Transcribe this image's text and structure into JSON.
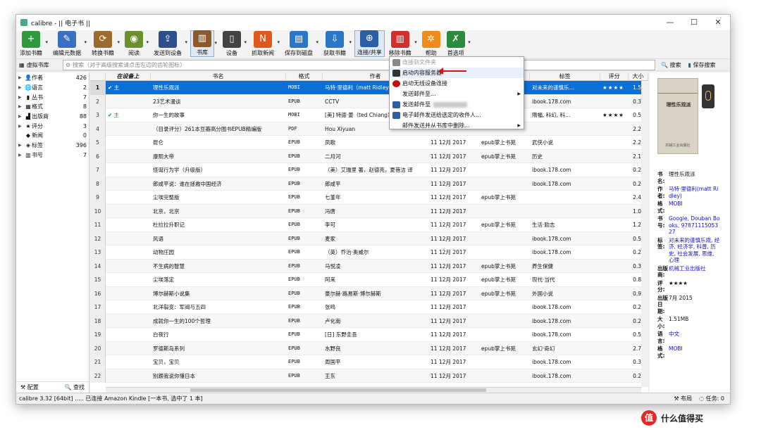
{
  "window": {
    "title": "calibre - || 电子书 ||",
    "minimize": "—",
    "maximize": "☐",
    "close": "✕"
  },
  "toolbar": [
    {
      "label": "添加书籍",
      "color": "#2e9a3a",
      "glyph": "+",
      "arrow": true
    },
    {
      "label": "编辑元数据",
      "color": "#3a6fc2",
      "glyph": "✎",
      "arrow": true
    },
    {
      "label": "转换书籍",
      "color": "#9b6a2f",
      "glyph": "⟳",
      "arrow": true
    },
    {
      "label": "阅读",
      "color": "#6b8f2e",
      "glyph": "◉",
      "arrow": true
    },
    {
      "label": "发送到设备",
      "color": "#2d4f8a",
      "glyph": "⇪",
      "arrow": true
    },
    {
      "label": "书库",
      "color": "#8a5a2c",
      "glyph": "▥",
      "arrow": true,
      "active": true
    },
    {
      "label": "设备",
      "color": "#444444",
      "glyph": "▯",
      "arrow": true
    },
    {
      "label": "抓取新闻",
      "color": "#e2571b",
      "glyph": "N",
      "arrow": true
    },
    {
      "label": "保存到磁盘",
      "color": "#2a77c9",
      "glyph": "▤",
      "arrow": true
    },
    {
      "label": "获取书籍",
      "color": "#2a77c9",
      "glyph": "⇩",
      "arrow": true
    },
    {
      "label": "连接/共享",
      "color": "#2a5fa8",
      "glyph": "⊕",
      "arrow": false,
      "active": true
    },
    {
      "label": "移除书籍",
      "color": "#d32d2d",
      "glyph": "▥",
      "arrow": true
    },
    {
      "label": "帮助",
      "color": "#f08a1a",
      "glyph": "✲",
      "arrow": false
    },
    {
      "label": "首选项",
      "color": "#2b8a3e",
      "glyph": "✗",
      "arrow": true
    }
  ],
  "search": {
    "virtual_library": "虚拟书库",
    "placeholder": "搜索（对于高级搜索请点击左边的齿轮图标）",
    "search_button": "搜索",
    "save_search_button": "保存搜索"
  },
  "tag_browser": {
    "items": [
      {
        "name": "作者",
        "count": "426",
        "icon": "👤",
        "expandable": true
      },
      {
        "name": "语言",
        "count": "2",
        "icon": "🌐",
        "expandable": true
      },
      {
        "name": "丛书",
        "count": "7",
        "icon": "▮",
        "expandable": true
      },
      {
        "name": "格式",
        "count": "8",
        "icon": "▦",
        "expandable": true
      },
      {
        "name": "出版商",
        "count": "88",
        "icon": "▟",
        "expandable": true
      },
      {
        "name": "评分",
        "count": "3",
        "icon": "★",
        "expandable": true
      },
      {
        "name": "新闻",
        "count": "0",
        "icon": "◆",
        "expandable": false
      },
      {
        "name": "标签",
        "count": "396",
        "icon": "◈",
        "expandable": true
      },
      {
        "name": "书号",
        "count": "7",
        "icon": "▥",
        "expandable": true
      }
    ],
    "configure": "配置",
    "find": "查找"
  },
  "book_list": {
    "columns": [
      "在设备上",
      "书名",
      "格式",
      "作者",
      "",
      "",
      "标签",
      "评分",
      "大小（M"
    ],
    "rows": [
      {
        "n": "1",
        "dev": "主",
        "check": true,
        "title": "理性乐观派",
        "fmt": "MOBI",
        "author": "马特·里德利（matt Ridley）",
        "date": "",
        "series": "",
        "tags": "对未来的谨慎乐…",
        "rating": "★★★★",
        "size": "1.5"
      },
      {
        "n": "2",
        "dev": "",
        "check": false,
        "title": "23艺术漫谈",
        "fmt": "EPUB",
        "author": "CCTV",
        "date": "",
        "series": "",
        "tags": "ibook.178.com",
        "rating": "",
        "size": "0.3"
      },
      {
        "n": "3",
        "dev": "主",
        "check": true,
        "title": "你一生的故事",
        "fmt": "MOBI",
        "author": "[美] 特德·姜（ted Chiang）",
        "date": "",
        "series": "",
        "tags": "隋幅, 科幻, 科…",
        "rating": "★★★★",
        "size": "0.5"
      },
      {
        "n": "4",
        "dev": "",
        "check": false,
        "title": "（目录评分）261本豆瓣高分图书EPUB精编版",
        "fmt": "PDF",
        "author": "Hou Xiyuan",
        "date": "",
        "series": "",
        "tags": "",
        "rating": "",
        "size": "2.2"
      },
      {
        "n": "5",
        "dev": "",
        "check": false,
        "title": "昆仑",
        "fmt": "EPUB",
        "author": "凤歌",
        "date": "11 12月 2017",
        "series": "epub掌上书苑",
        "tags": "武侠小说",
        "rating": "",
        "size": "2.2"
      },
      {
        "n": "6",
        "dev": "",
        "check": false,
        "title": "康熙大帝",
        "fmt": "EPUB",
        "author": "二月河",
        "date": "11 12月 2017",
        "series": "epub掌上书苑",
        "tags": "历史",
        "rating": "",
        "size": "2.1"
      },
      {
        "n": "7",
        "dev": "",
        "check": false,
        "title": "怪诞行为学（升级版）",
        "fmt": "EPUB",
        "author": "（美）艾瑞里 著，赵德亮，夏蓓洁 译",
        "date": "11 12月 2017",
        "series": "",
        "tags": "ibook.178.com",
        "rating": "",
        "size": "0.2"
      },
      {
        "n": "8",
        "dev": "",
        "check": false,
        "title": "郎咸平说：谁在拯救中国经济",
        "fmt": "EPUB",
        "author": "郎咸平",
        "date": "11 12月 2017",
        "series": "",
        "tags": "ibook.178.com",
        "rating": "",
        "size": "0.2"
      },
      {
        "n": "9",
        "dev": "",
        "check": false,
        "title": "尘埃完整版",
        "fmt": "EPUB",
        "author": "七堇年",
        "date": "11 12月 2017",
        "series": "epub掌上书苑",
        "tags": "",
        "rating": "",
        "size": "2.4"
      },
      {
        "n": "10",
        "dev": "",
        "check": false,
        "title": "北京，北京",
        "fmt": "EPUB",
        "author": "冯唐",
        "date": "11 12月 2017",
        "series": "",
        "tags": "",
        "rating": "",
        "size": "1.0"
      },
      {
        "n": "11",
        "dev": "",
        "check": false,
        "title": "杜拉拉升职记",
        "fmt": "EPUB",
        "author": "李可",
        "date": "11 12月 2017",
        "series": "epub掌上书苑",
        "tags": "生活·励志",
        "rating": "",
        "size": "1.2"
      },
      {
        "n": "12",
        "dev": "",
        "check": false,
        "title": "风语",
        "fmt": "EPUB",
        "author": "麦家",
        "date": "11 12月 2017",
        "series": "",
        "tags": "ibook.178.com",
        "rating": "",
        "size": "0.5"
      },
      {
        "n": "13",
        "dev": "",
        "check": false,
        "title": "动物庄园",
        "fmt": "EPUB",
        "author": "（英）乔治·奥威尔",
        "date": "11 12月 2017",
        "series": "",
        "tags": "ibook.178.com",
        "rating": "",
        "size": "0.2"
      },
      {
        "n": "14",
        "dev": "",
        "check": false,
        "title": "不生病的智慧",
        "fmt": "EPUB",
        "author": "马悦凌",
        "date": "11 12月 2017",
        "series": "epub掌上书苑",
        "tags": "养生保健",
        "rating": "",
        "size": "0.3"
      },
      {
        "n": "15",
        "dev": "",
        "check": false,
        "title": "尘埃落定",
        "fmt": "EPUB",
        "author": "阿来",
        "date": "11 12月 2017",
        "series": "epub掌上书苑",
        "tags": "现代·当代",
        "rating": "",
        "size": "0.8"
      },
      {
        "n": "16",
        "dev": "",
        "check": false,
        "title": "博尔赫斯小说集",
        "fmt": "EPUB",
        "author": "豪尔赫·路易斯·博尔赫斯",
        "date": "11 12月 2017",
        "series": "epub掌上书苑",
        "tags": "外国小说",
        "rating": "",
        "size": "0.9"
      },
      {
        "n": "17",
        "dev": "",
        "check": false,
        "title": "北洋裂变：军阀与五四",
        "fmt": "EPUB",
        "author": "张鸣",
        "date": "11 12月 2017",
        "series": "",
        "tags": "ibook.178.com",
        "rating": "",
        "size": "0.2"
      },
      {
        "n": "18",
        "dev": "",
        "check": false,
        "title": "成就你一生的100个哲理",
        "fmt": "EPUB",
        "author": "卢化南",
        "date": "11 12月 2017",
        "series": "",
        "tags": "ibook.178.com",
        "rating": "",
        "size": "0.2"
      },
      {
        "n": "19",
        "dev": "",
        "check": false,
        "title": "白夜行",
        "fmt": "EPUB",
        "author": "[日] 东野圭吾",
        "date": "11 12月 2017",
        "series": "",
        "tags": "ibook.178.com",
        "rating": "",
        "size": "0.5"
      },
      {
        "n": "20",
        "dev": "",
        "check": false,
        "title": "罗德斯岛系列",
        "fmt": "EPUB",
        "author": "水野良",
        "date": "11 12月 2017",
        "series": "epub掌上书苑",
        "tags": "玄幻·奇幻",
        "rating": "",
        "size": "2.7"
      },
      {
        "n": "21",
        "dev": "",
        "check": false,
        "title": "宝贝，宝贝",
        "fmt": "EPUB",
        "author": "周国平",
        "date": "11 12月 2017",
        "series": "",
        "tags": "ibook.178.com",
        "rating": "",
        "size": "0.3"
      },
      {
        "n": "22",
        "dev": "",
        "check": false,
        "title": "别跟我说你懂日本",
        "fmt": "EPUB",
        "author": "王东",
        "date": "11 12月 2017",
        "series": "",
        "tags": "ibook.178.com",
        "rating": "",
        "size": "0.2"
      }
    ]
  },
  "connect_menu": {
    "items": [
      {
        "label": "连接到文件夹",
        "disabled": true,
        "icon": "#888888",
        "submenu": false
      },
      {
        "label": "启动内容服务器",
        "disabled": false,
        "icon": "#333333",
        "submenu": false
      },
      {
        "label": "启动无线设备连接",
        "disabled": false,
        "icon": "#c01010",
        "submenu": false
      },
      {
        "label": "发送邮件至...",
        "disabled": false,
        "icon": "",
        "submenu": true
      },
      {
        "label": "发送邮件至",
        "disabled": false,
        "icon": "#2a5fa8",
        "submenu": false
      },
      {
        "label": "电子邮件发送给选定的收件人...",
        "disabled": false,
        "icon": "#2a5fa8",
        "submenu": false
      },
      {
        "label": "邮件发送并从书库中删除...",
        "disabled": false,
        "icon": "",
        "submenu": true
      }
    ]
  },
  "details": {
    "cover_title": "理性乐观派",
    "cover_publisher": "机械工业出版社",
    "fields": [
      {
        "key": "书名:",
        "value": "理性乐观派",
        "link": false
      },
      {
        "key": "作者:",
        "value": "马特·里德利(matt Ridley)",
        "link": true
      },
      {
        "key": "格式:",
        "value": "MOBI",
        "link": true
      },
      {
        "key": "书号:",
        "value": "Google, Douban Books, 9787111505327",
        "link": true
      },
      {
        "key": "标签:",
        "value": "对未来的谨慎乐观, 经济, 经济学, 科普, 历史, 社会发展, 思维, 心理",
        "link": true
      },
      {
        "key": "出版商:",
        "value": "机械工业出版社",
        "link": true
      },
      {
        "key": "评分:",
        "value": "★★★★",
        "link": false
      },
      {
        "key": "出版日期:",
        "value": "7月 2015",
        "link": false
      },
      {
        "key": "大小:",
        "value": "1.51MB",
        "link": false
      },
      {
        "key": "语言:",
        "value": "中文",
        "link": true
      },
      {
        "key": "格式:",
        "value": "MOBI",
        "link": true
      }
    ]
  },
  "status": {
    "left": "calibre 3.32 [64bit] ..... 已连接 Amazon Kindle  [一本书, 选中了 1 本]",
    "layout": "布局",
    "jobs": "任务: 0"
  },
  "watermark": {
    "logo": "值",
    "text": "什么值得买"
  }
}
